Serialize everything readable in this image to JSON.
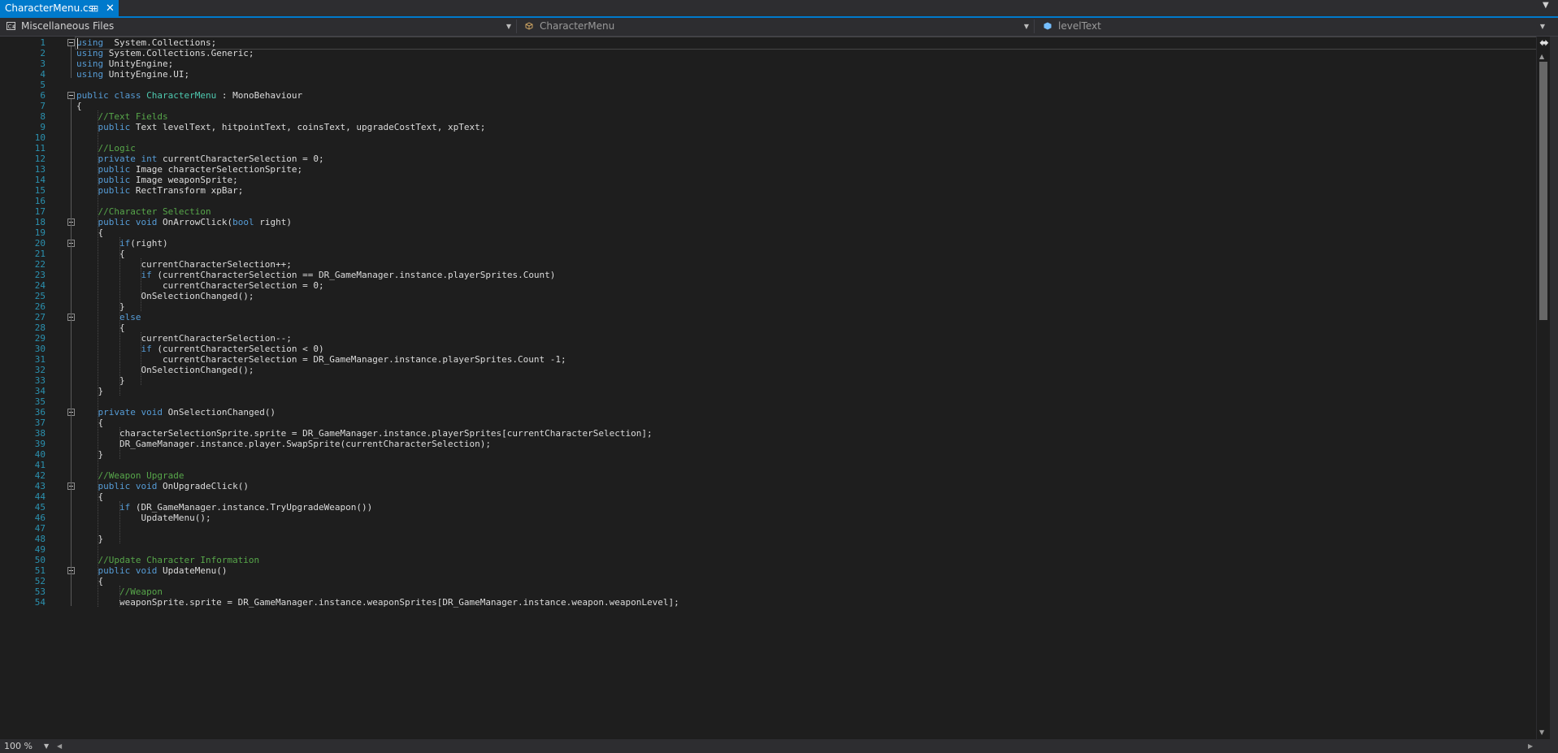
{
  "tab": {
    "title": "CharacterMenu.cs",
    "pin_icon": "pin-icon",
    "close_icon": "close-icon"
  },
  "navbar": {
    "project": "Miscellaneous Files",
    "type": "CharacterMenu",
    "member": "levelText"
  },
  "status": {
    "zoom": "100 %"
  },
  "colors": {
    "accent": "#007acc",
    "background": "#1e1e1e",
    "keyword": "#569cd6",
    "type": "#4ec9b0",
    "comment": "#57a64a",
    "line_number": "#2b91af"
  },
  "editor": {
    "line_numbers": [
      "1",
      "2",
      "3",
      "4",
      "5",
      "6",
      "7",
      "8",
      "9",
      "10",
      "11",
      "12",
      "13",
      "14",
      "15",
      "16",
      "17",
      "18",
      "19",
      "20",
      "21",
      "22",
      "23",
      "24",
      "25",
      "26",
      "27",
      "28",
      "29",
      "30",
      "31",
      "32",
      "33",
      "34",
      "35",
      "36",
      "37",
      "38",
      "39",
      "40",
      "41",
      "42",
      "43",
      "44",
      "45",
      "46",
      "47",
      "48",
      "49",
      "50",
      "51",
      "52",
      "53",
      "54"
    ],
    "lines": [
      [
        [
          "kw",
          "using"
        ],
        [
          "",
          "  System.Collections;"
        ]
      ],
      [
        [
          "kw",
          "using"
        ],
        [
          "",
          " System.Collections.Generic;"
        ]
      ],
      [
        [
          "kw",
          "using"
        ],
        [
          "",
          " UnityEngine;"
        ]
      ],
      [
        [
          "kw",
          "using"
        ],
        [
          "",
          " UnityEngine.UI;"
        ]
      ],
      [],
      [
        [
          "kw",
          "public"
        ],
        [
          "",
          " "
        ],
        [
          "kw",
          "class"
        ],
        [
          "",
          " "
        ],
        [
          "ty",
          "CharacterMenu"
        ],
        [
          "",
          " : MonoBehaviour"
        ]
      ],
      [
        [
          "",
          "{"
        ]
      ],
      [
        [
          "",
          "    "
        ],
        [
          "cm",
          "//Text Fields"
        ]
      ],
      [
        [
          "",
          "    "
        ],
        [
          "kw",
          "public"
        ],
        [
          "",
          " Text levelText, hitpointText, coinsText, upgradeCostText, xpText;"
        ]
      ],
      [],
      [
        [
          "",
          "    "
        ],
        [
          "cm",
          "//Logic"
        ]
      ],
      [
        [
          "",
          "    "
        ],
        [
          "kw",
          "private"
        ],
        [
          "",
          " "
        ],
        [
          "kw",
          "int"
        ],
        [
          "",
          " currentCharacterSelection = 0;"
        ]
      ],
      [
        [
          "",
          "    "
        ],
        [
          "kw",
          "public"
        ],
        [
          "",
          " Image characterSelectionSprite;"
        ]
      ],
      [
        [
          "",
          "    "
        ],
        [
          "kw",
          "public"
        ],
        [
          "",
          " Image weaponSprite;"
        ]
      ],
      [
        [
          "",
          "    "
        ],
        [
          "kw",
          "public"
        ],
        [
          "",
          " RectTransform xpBar;"
        ]
      ],
      [],
      [
        [
          "",
          "    "
        ],
        [
          "cm",
          "//Character Selection"
        ]
      ],
      [
        [
          "",
          "    "
        ],
        [
          "kw",
          "public"
        ],
        [
          "",
          " "
        ],
        [
          "kw",
          "void"
        ],
        [
          "",
          " OnArrowClick("
        ],
        [
          "kw",
          "bool"
        ],
        [
          "",
          " right)"
        ]
      ],
      [
        [
          "",
          "    {"
        ]
      ],
      [
        [
          "",
          "        "
        ],
        [
          "kw",
          "if"
        ],
        [
          "",
          "(right)"
        ]
      ],
      [
        [
          "",
          "        {"
        ]
      ],
      [
        [
          "",
          "            currentCharacterSelection++;"
        ]
      ],
      [
        [
          "",
          "            "
        ],
        [
          "kw",
          "if"
        ],
        [
          "",
          " (currentCharacterSelection == DR_GameManager.instance.playerSprites.Count)"
        ]
      ],
      [
        [
          "",
          "                currentCharacterSelection = 0;"
        ]
      ],
      [
        [
          "",
          "            OnSelectionChanged();"
        ]
      ],
      [
        [
          "",
          "        }"
        ]
      ],
      [
        [
          "",
          "        "
        ],
        [
          "kw",
          "else"
        ]
      ],
      [
        [
          "",
          "        {"
        ]
      ],
      [
        [
          "",
          "            currentCharacterSelection--;"
        ]
      ],
      [
        [
          "",
          "            "
        ],
        [
          "kw",
          "if"
        ],
        [
          "",
          " (currentCharacterSelection < 0)"
        ]
      ],
      [
        [
          "",
          "                currentCharacterSelection = DR_GameManager.instance.playerSprites.Count -1;"
        ]
      ],
      [
        [
          "",
          "            OnSelectionChanged();"
        ]
      ],
      [
        [
          "",
          "        }"
        ]
      ],
      [
        [
          "",
          "    }"
        ]
      ],
      [],
      [
        [
          "",
          "    "
        ],
        [
          "kw",
          "private"
        ],
        [
          "",
          " "
        ],
        [
          "kw",
          "void"
        ],
        [
          "",
          " OnSelectionChanged()"
        ]
      ],
      [
        [
          "",
          "    {"
        ]
      ],
      [
        [
          "",
          "        characterSelectionSprite.sprite = DR_GameManager.instance.playerSprites[currentCharacterSelection];"
        ]
      ],
      [
        [
          "",
          "        DR_GameManager.instance.player.SwapSprite(currentCharacterSelection);"
        ]
      ],
      [
        [
          "",
          "    }"
        ]
      ],
      [],
      [
        [
          "",
          "    "
        ],
        [
          "cm",
          "//Weapon Upgrade"
        ]
      ],
      [
        [
          "",
          "    "
        ],
        [
          "kw",
          "public"
        ],
        [
          "",
          " "
        ],
        [
          "kw",
          "void"
        ],
        [
          "",
          " OnUpgradeClick()"
        ]
      ],
      [
        [
          "",
          "    {"
        ]
      ],
      [
        [
          "",
          "        "
        ],
        [
          "kw",
          "if"
        ],
        [
          "",
          " (DR_GameManager.instance.TryUpgradeWeapon())"
        ]
      ],
      [
        [
          "",
          "            UpdateMenu();"
        ]
      ],
      [],
      [
        [
          "",
          "    }"
        ]
      ],
      [],
      [
        [
          "",
          "    "
        ],
        [
          "cm",
          "//Update Character Information"
        ]
      ],
      [
        [
          "",
          "    "
        ],
        [
          "kw",
          "public"
        ],
        [
          "",
          " "
        ],
        [
          "kw",
          "void"
        ],
        [
          "",
          " UpdateMenu()"
        ]
      ],
      [
        [
          "",
          "    {"
        ]
      ],
      [
        [
          "",
          "        "
        ],
        [
          "cm",
          "//Weapon"
        ]
      ],
      [
        [
          "",
          "        weaponSprite.sprite = DR_GameManager.instance.weaponSprites[DR_GameManager.instance.weapon.weaponLevel];"
        ]
      ]
    ]
  }
}
